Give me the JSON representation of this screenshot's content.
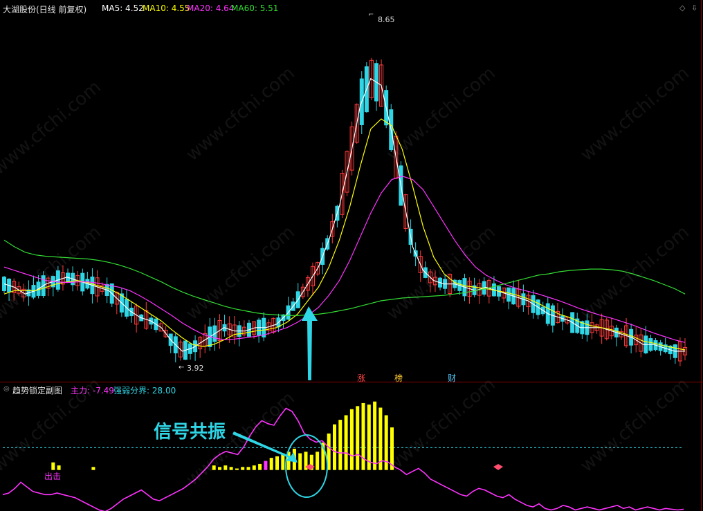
{
  "header": {
    "title": "大湖股份(日线 前复权)",
    "ma5": "MA5: 4.52",
    "ma10": "MA10: 4.55",
    "ma20": "MA20: 4.64",
    "ma60": "MA60: 5.51",
    "colors": {
      "ma5": "#ffffff",
      "ma10": "#ffff00",
      "ma20": "#ff33ff",
      "ma60": "#33dd33"
    }
  },
  "main_chart": {
    "high_label": "8.65",
    "low_label": "3.92",
    "event_tags": [
      "涨",
      "榜",
      "财"
    ]
  },
  "sub_header": {
    "title": "趋势锁定副图",
    "zhuli": "主力: -7.49",
    "qiangruo": "强弱分界: 28.00"
  },
  "sub_chart": {
    "tag_left": "出击",
    "annotation": "信号共振"
  },
  "watermark": "www.cfchi.com",
  "chart_data": [
    {
      "type": "line",
      "title": "大湖股份(日线 前复权)",
      "ylim": [
        3.6,
        8.9
      ],
      "series": [
        {
          "name": "MA5",
          "color": "#ffffff",
          "values": [
            4.95,
            4.9,
            4.8,
            4.85,
            4.95,
            5.0,
            5.05,
            5.0,
            4.95,
            4.9,
            4.85,
            4.7,
            4.55,
            4.45,
            4.4,
            4.3,
            4.1,
            3.95,
            4.0,
            4.1,
            4.2,
            4.3,
            4.25,
            4.25,
            4.3,
            4.3,
            4.35,
            4.5,
            4.7,
            4.95,
            5.2,
            5.6,
            6.1,
            6.8,
            7.6,
            8.0,
            7.9,
            7.2,
            6.3,
            5.5,
            5.15,
            5.0,
            4.95,
            4.95,
            4.9,
            4.85,
            4.9,
            4.85,
            4.8,
            4.75,
            4.7,
            4.6,
            4.5,
            4.45,
            4.4,
            4.3,
            4.3,
            4.3,
            4.25,
            4.2,
            4.15,
            4.05,
            4.05,
            4.0,
            3.95,
            3.95
          ]
        },
        {
          "name": "MA10",
          "color": "#ffff00",
          "values": [
            4.8,
            4.85,
            4.85,
            4.85,
            4.9,
            4.95,
            4.98,
            5.0,
            4.97,
            4.92,
            4.88,
            4.8,
            4.7,
            4.6,
            4.5,
            4.4,
            4.27,
            4.15,
            4.05,
            4.02,
            4.05,
            4.12,
            4.2,
            4.22,
            4.25,
            4.27,
            4.3,
            4.38,
            4.5,
            4.7,
            4.9,
            5.2,
            5.6,
            6.1,
            6.7,
            7.25,
            7.4,
            7.3,
            6.95,
            6.4,
            5.8,
            5.35,
            5.1,
            4.97,
            4.92,
            4.9,
            4.88,
            4.85,
            4.82,
            4.78,
            4.73,
            4.66,
            4.58,
            4.5,
            4.45,
            4.38,
            4.33,
            4.3,
            4.27,
            4.22,
            4.17,
            4.1,
            4.07,
            4.03,
            4.0,
            3.97
          ]
        },
        {
          "name": "MA20",
          "color": "#ff33ff",
          "values": [
            5.2,
            5.15,
            5.1,
            5.05,
            5.0,
            4.98,
            4.97,
            4.98,
            4.98,
            4.96,
            4.93,
            4.9,
            4.85,
            4.77,
            4.68,
            4.58,
            4.48,
            4.37,
            4.28,
            4.2,
            4.15,
            4.12,
            4.13,
            4.15,
            4.17,
            4.2,
            4.25,
            4.3,
            4.38,
            4.48,
            4.6,
            4.78,
            5.0,
            5.3,
            5.65,
            6.0,
            6.3,
            6.5,
            6.55,
            6.5,
            6.35,
            6.1,
            5.85,
            5.6,
            5.38,
            5.2,
            5.08,
            5.0,
            4.93,
            4.88,
            4.84,
            4.8,
            4.75,
            4.7,
            4.64,
            4.58,
            4.53,
            4.48,
            4.44,
            4.39,
            4.34,
            4.28,
            4.22,
            4.17,
            4.12,
            4.08
          ]
        },
        {
          "name": "MA60",
          "color": "#33dd33",
          "values": [
            5.6,
            5.5,
            5.42,
            5.38,
            5.36,
            5.35,
            5.34,
            5.33,
            5.32,
            5.3,
            5.27,
            5.23,
            5.18,
            5.12,
            5.05,
            4.98,
            4.9,
            4.83,
            4.77,
            4.72,
            4.67,
            4.62,
            4.58,
            4.55,
            4.52,
            4.5,
            4.49,
            4.48,
            4.48,
            4.49,
            4.5,
            4.52,
            4.55,
            4.58,
            4.62,
            4.66,
            4.7,
            4.72,
            4.74,
            4.75,
            4.76,
            4.77,
            4.78,
            4.8,
            4.82,
            4.85,
            4.88,
            4.92,
            4.96,
            5.0,
            5.04,
            5.08,
            5.1,
            5.13,
            5.15,
            5.16,
            5.17,
            5.17,
            5.16,
            5.14,
            5.1,
            5.05,
            5.0,
            4.94,
            4.88,
            4.8
          ]
        }
      ]
    },
    {
      "type": "bar",
      "title": "趋势锁定副图",
      "threshold": 28.0,
      "ylim": [
        -10,
        60
      ],
      "series": [
        {
          "name": "主力",
          "type": "line",
          "color": "#ff33ff",
          "values": [
            2,
            3,
            6,
            10,
            7,
            4,
            3,
            2,
            2,
            3,
            2,
            1,
            0,
            -2,
            -4,
            -6,
            -8,
            -9,
            -7,
            -4,
            -1,
            1,
            3,
            5,
            2,
            -1,
            -2,
            0,
            2,
            4,
            6,
            9,
            12,
            16,
            20,
            25,
            28,
            30,
            29,
            28,
            33,
            40,
            46,
            50,
            48,
            47,
            53,
            58,
            56,
            50,
            42,
            38,
            36,
            37,
            33,
            30,
            29,
            29,
            27,
            28,
            25,
            23,
            22,
            24,
            23,
            20,
            18,
            15,
            17,
            19,
            16,
            12,
            10,
            8,
            6,
            4,
            2,
            1,
            4,
            6,
            5,
            3,
            1,
            0,
            2,
            -1,
            -3,
            -5,
            -6,
            -4,
            -7,
            -8,
            -7,
            -5,
            -6,
            -8,
            -7,
            -6,
            -7,
            -8,
            -7,
            -6,
            -5,
            -7,
            -6,
            -8,
            -7,
            -6,
            -7,
            -8,
            -7,
            -7.5,
            -8,
            -7.49
          ]
        },
        {
          "name": "bars",
          "type": "bar",
          "color": "#ffff00",
          "values": [
            0,
            5,
            3,
            0,
            0,
            0,
            0,
            0,
            2,
            0,
            0,
            0,
            0,
            0,
            0,
            0,
            0,
            0,
            0,
            0,
            0,
            0,
            0,
            0,
            0,
            0,
            0,
            0,
            0,
            3,
            2,
            3,
            2,
            1,
            2,
            2,
            3,
            4,
            6,
            8,
            9,
            11,
            12,
            14,
            11,
            12,
            10,
            12,
            18,
            24,
            30,
            33,
            36,
            40,
            42,
            44,
            43,
            45,
            41,
            36,
            28
          ]
        }
      ]
    }
  ]
}
